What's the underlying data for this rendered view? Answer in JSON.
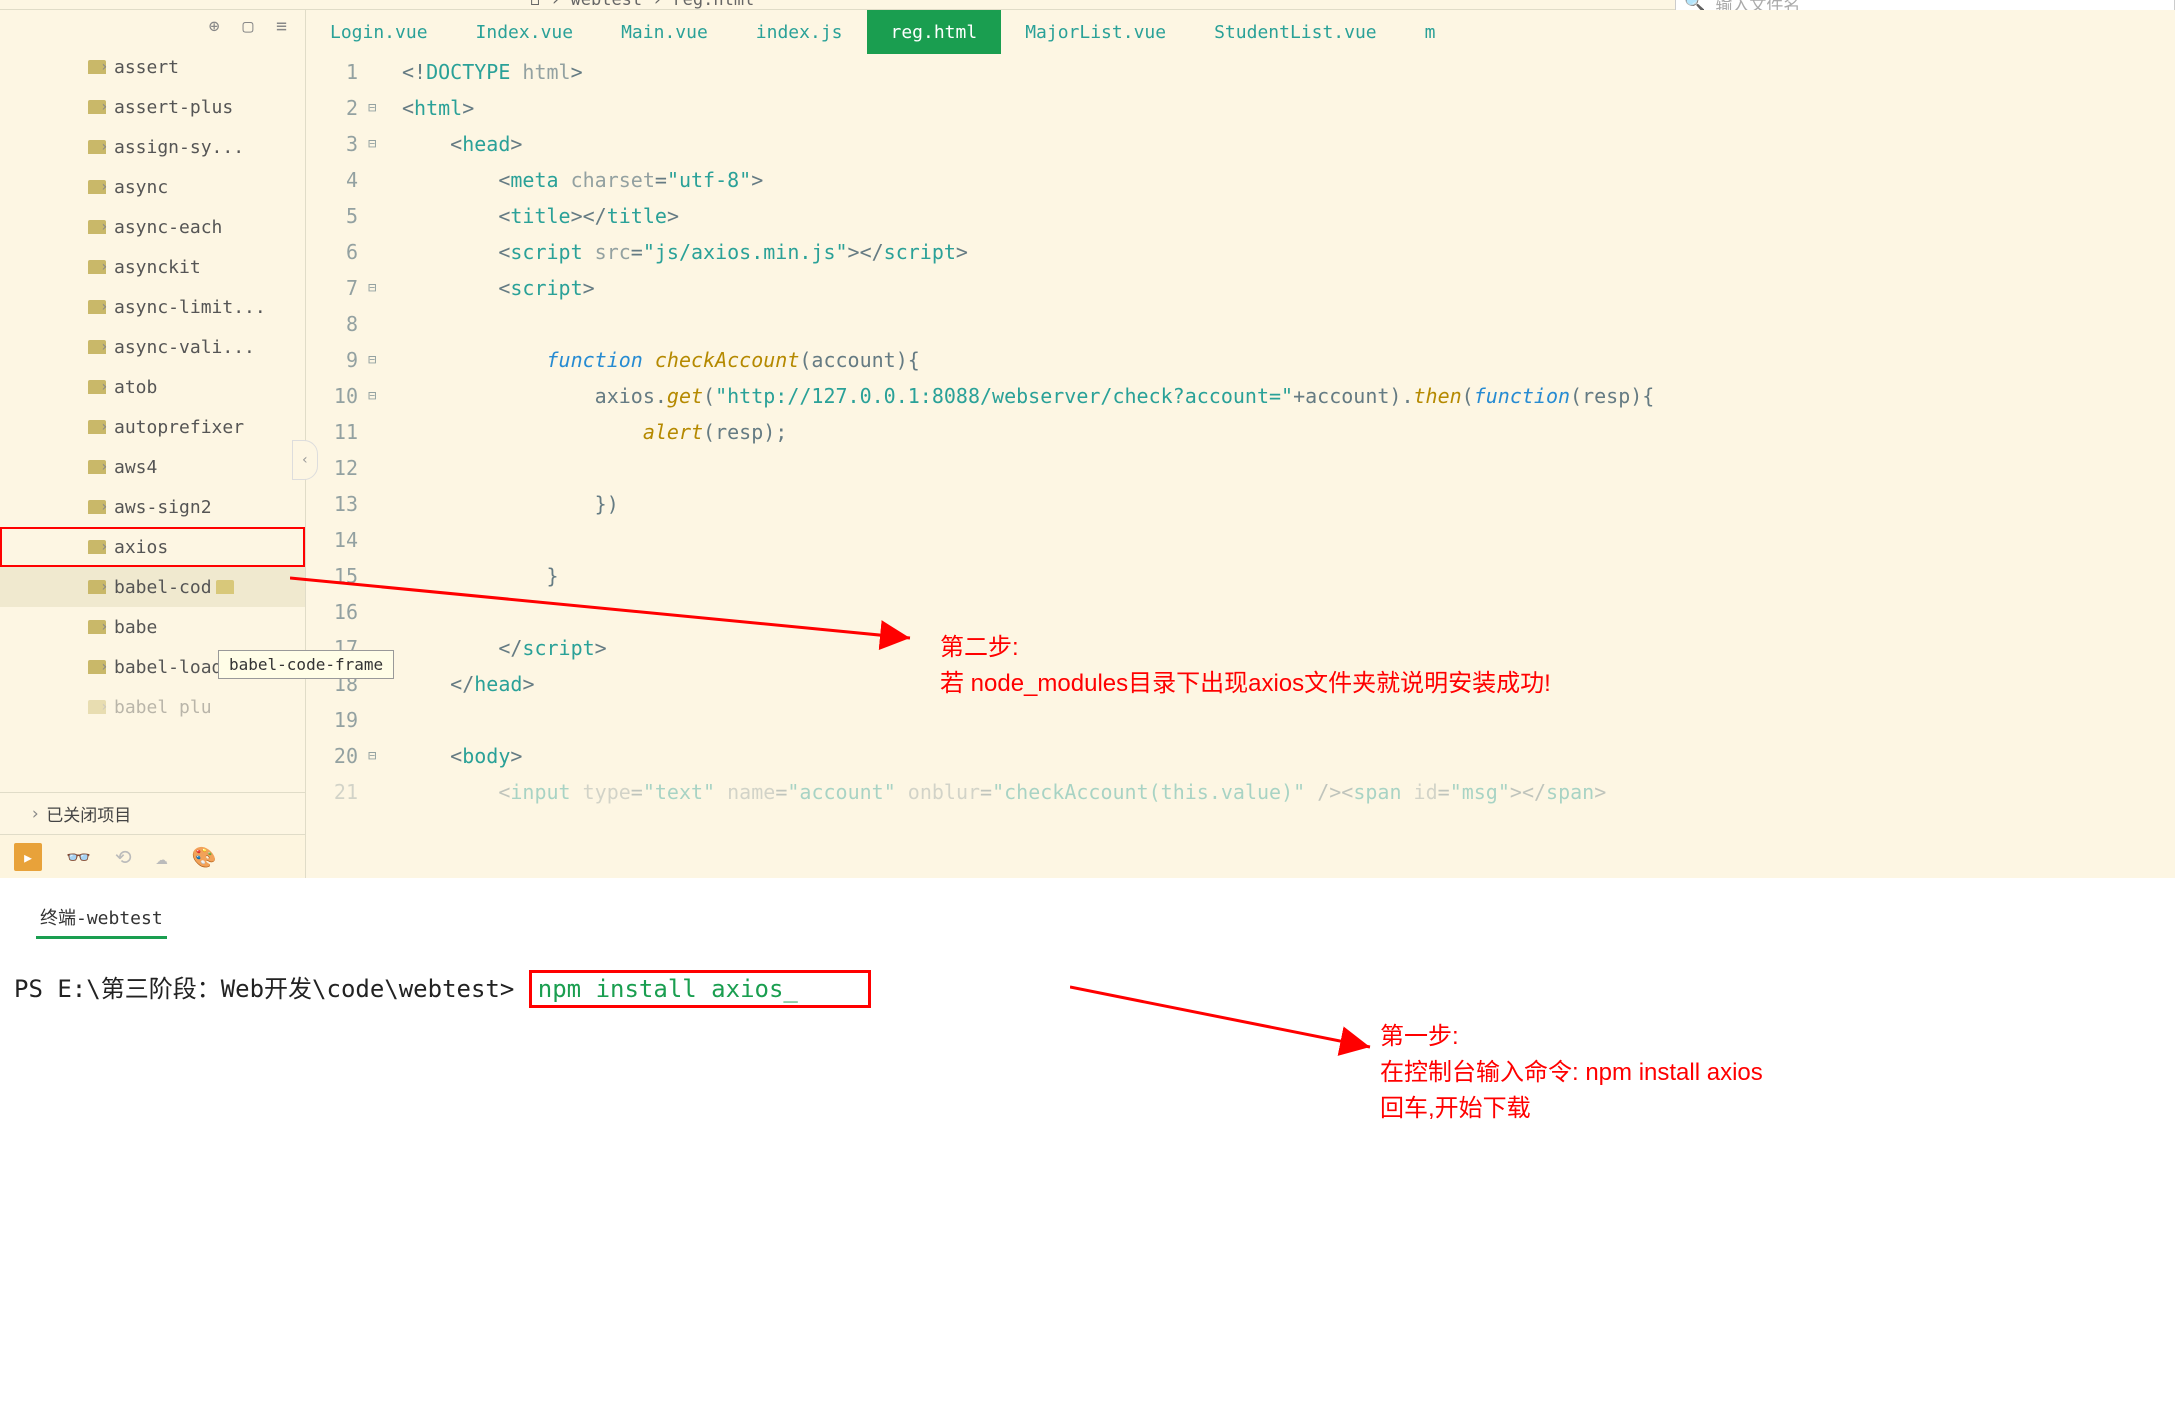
{
  "breadcrumb": {
    "project": "webtest",
    "file": "reg.html"
  },
  "search": {
    "placeholder": "输入文件名"
  },
  "sidebar": {
    "items": [
      {
        "label": "assert"
      },
      {
        "label": "assert-plus"
      },
      {
        "label": "assign-sy..."
      },
      {
        "label": "async"
      },
      {
        "label": "async-each"
      },
      {
        "label": "asynckit"
      },
      {
        "label": "async-limit..."
      },
      {
        "label": "async-vali..."
      },
      {
        "label": "atob"
      },
      {
        "label": "autoprefixer"
      },
      {
        "label": "aws4"
      },
      {
        "label": "aws-sign2"
      },
      {
        "label": "axios"
      },
      {
        "label": "babel-cod"
      },
      {
        "label": "babe"
      },
      {
        "label": "babel-load..."
      },
      {
        "label": "babel plu"
      }
    ],
    "closed": "已关闭项目"
  },
  "tooltip": "babel-code-frame",
  "tabs": [
    {
      "label": "Login.vue"
    },
    {
      "label": "Index.vue"
    },
    {
      "label": "Main.vue"
    },
    {
      "label": "index.js"
    },
    {
      "label": "reg.html"
    },
    {
      "label": "MajorList.vue"
    },
    {
      "label": "StudentList.vue"
    },
    {
      "label": "m"
    }
  ],
  "code": {
    "l1a": "<!",
    "l1b": "DOCTYPE ",
    "l1c": "html",
    "l1d": ">",
    "l2a": "<",
    "l2b": "html",
    "l2c": ">",
    "l3a": "<",
    "l3b": "head",
    "l3c": ">",
    "l4a": "<",
    "l4b": "meta ",
    "l4c": "charset",
    "l4d": "=",
    "l4e": "\"utf-8\"",
    "l4f": ">",
    "l5a": "<",
    "l5b": "title",
    "l5c": "></",
    "l5d": "title",
    "l5e": ">",
    "l6a": "<",
    "l6b": "script ",
    "l6c": "src",
    "l6d": "=",
    "l6e": "\"js/axios.min.js\"",
    "l6f": "></",
    "l6g": "script",
    "l6h": ">",
    "l7a": "<",
    "l7b": "script",
    "l7c": ">",
    "l9a": "function",
    "l9b": " ",
    "l9c": "checkAccount",
    "l9d": "(",
    "l9e": "account",
    "l9f": "){",
    "l10a": "axios",
    "l10b": ".",
    "l10c": "get",
    "l10d": "(",
    "l10e": "\"http://127.0.0.1:8088/webserver/check?account=\"",
    "l10f": "+",
    "l10g": "account",
    "l10h": ").",
    "l10i": "then",
    "l10j": "(",
    "l10k": "function",
    "l10l": "(",
    "l10m": "resp",
    "l10n": "){",
    "l11a": "alert",
    "l11b": "(",
    "l11c": "resp",
    "l11d": ");",
    "l13a": "})",
    "l15a": "}",
    "l17a": "</",
    "l17b": "script",
    "l17c": ">",
    "l18a": "</",
    "l18b": "head",
    "l18c": ">",
    "l20a": "<",
    "l20b": "body",
    "l20c": ">",
    "l21a": "<",
    "l21b": "input ",
    "l21c": "type",
    "l21d": "=",
    "l21e": "\"text\"",
    "l21f": " ",
    "l21g": "name",
    "l21h": "=",
    "l21i": "\"account\"",
    "l21j": " ",
    "l21k": "onblur",
    "l21l": "=",
    "l21m": "\"checkAccount(this.value)\"",
    "l21n": " /><",
    "l21o": "span ",
    "l21p": "id",
    "l21q": "=",
    "l21r": "\"msg\"",
    "l21s": "></",
    "l21t": "span",
    "l21u": ">"
  },
  "annotations": {
    "step2_title": "第二步:",
    "step2_text": "若 node_modules目录下出现axios文件夹就说明安装成功!",
    "step1_title": "第一步:",
    "step1_line1": "在控制台输入命令: npm install axios",
    "step1_line2": "回车,开始下载"
  },
  "terminal": {
    "tab": "终端-webtest",
    "prompt": "PS E:\\第三阶段：Web开发\\code\\webtest> ",
    "cmd": "npm install axios"
  }
}
